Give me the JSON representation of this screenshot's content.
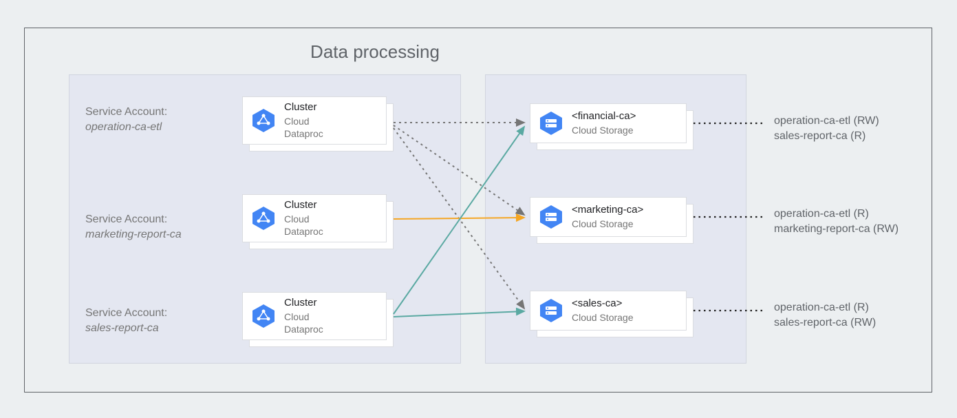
{
  "title": "Data processing",
  "service_accounts": [
    {
      "heading": "Service Account:",
      "name": "operation-ca-etl"
    },
    {
      "heading": "Service Account:",
      "name": "marketing-report-ca"
    },
    {
      "heading": "Service Account:",
      "name": "sales-report-ca"
    }
  ],
  "clusters": [
    {
      "title": "Cluster",
      "line1": "Cloud",
      "line2": "Dataproc"
    },
    {
      "title": "Cluster",
      "line1": "Cloud",
      "line2": "Dataproc"
    },
    {
      "title": "Cluster",
      "line1": "Cloud",
      "line2": "Dataproc"
    }
  ],
  "buckets": [
    {
      "title": "<financial-ca>",
      "subtitle": "Cloud Storage"
    },
    {
      "title": "<marketing-ca>",
      "subtitle": "Cloud Storage"
    },
    {
      "title": "<sales-ca>",
      "subtitle": "Cloud Storage"
    }
  ],
  "permissions": [
    {
      "line1": "operation-ca-etl (RW)",
      "line2": "sales-report-ca (R)"
    },
    {
      "line1": "operation-ca-etl (R)",
      "line2": "marketing-report-ca (RW)"
    },
    {
      "line1": "operation-ca-etl (R)",
      "line2": "sales-report-ca (RW)"
    }
  ],
  "colors": {
    "gcp_blue": "#4285f4",
    "teal_arrow": "#5aa9a2",
    "orange_arrow": "#f5a623",
    "gray_dotted": "#757575",
    "black_dotted": "#212121"
  }
}
